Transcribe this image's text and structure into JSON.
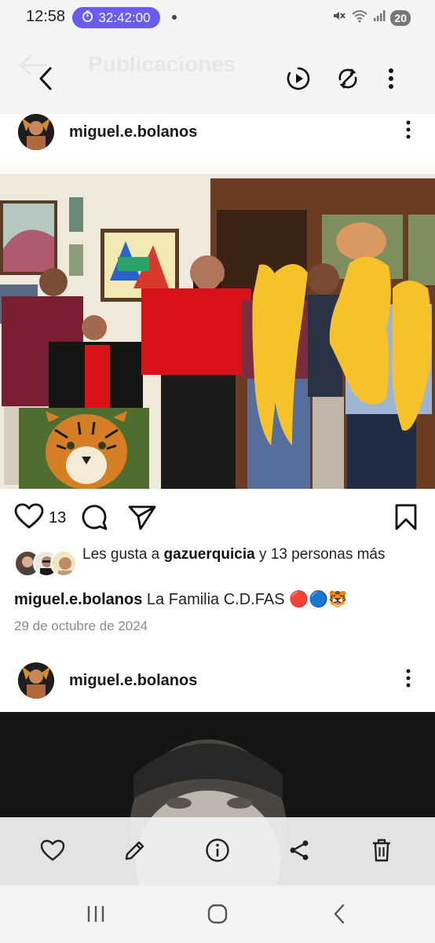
{
  "status_bar": {
    "time": "12:58",
    "timer": "32:42:00",
    "battery": "20",
    "icons": [
      "mute-icon",
      "wifi-icon",
      "signal-icon"
    ]
  },
  "header": {
    "ghost_title": "Publicaciones",
    "icons": [
      "back-arrow-icon",
      "play-reel-icon",
      "sync-icon",
      "more-vertical-icon"
    ]
  },
  "posts": [
    {
      "username": "miguel.e.bolanos",
      "like_count": "13",
      "likes": {
        "prefix": "Les gusta a",
        "user": "gazuerquicia",
        "suffix": "y 13 personas más"
      },
      "caption": {
        "user": "miguel.e.bolanos",
        "text": "La Familia C.D.FAS 🔴🔵🐯"
      },
      "date": "29 de octubre de 2024"
    },
    {
      "username": "miguel.e.bolanos"
    }
  ],
  "bottom_toolbar": {
    "icons": [
      "heart-outline-icon",
      "edit-pencil-icon",
      "info-icon",
      "share-icon",
      "trash-icon"
    ]
  },
  "nav": {
    "icons": [
      "recents-icon",
      "home-icon",
      "back-icon"
    ]
  },
  "colors": {
    "timer_pill": "#6a5cf2",
    "highlight_yellow": "#f7c12a",
    "shirt_red": "#d9121a"
  }
}
